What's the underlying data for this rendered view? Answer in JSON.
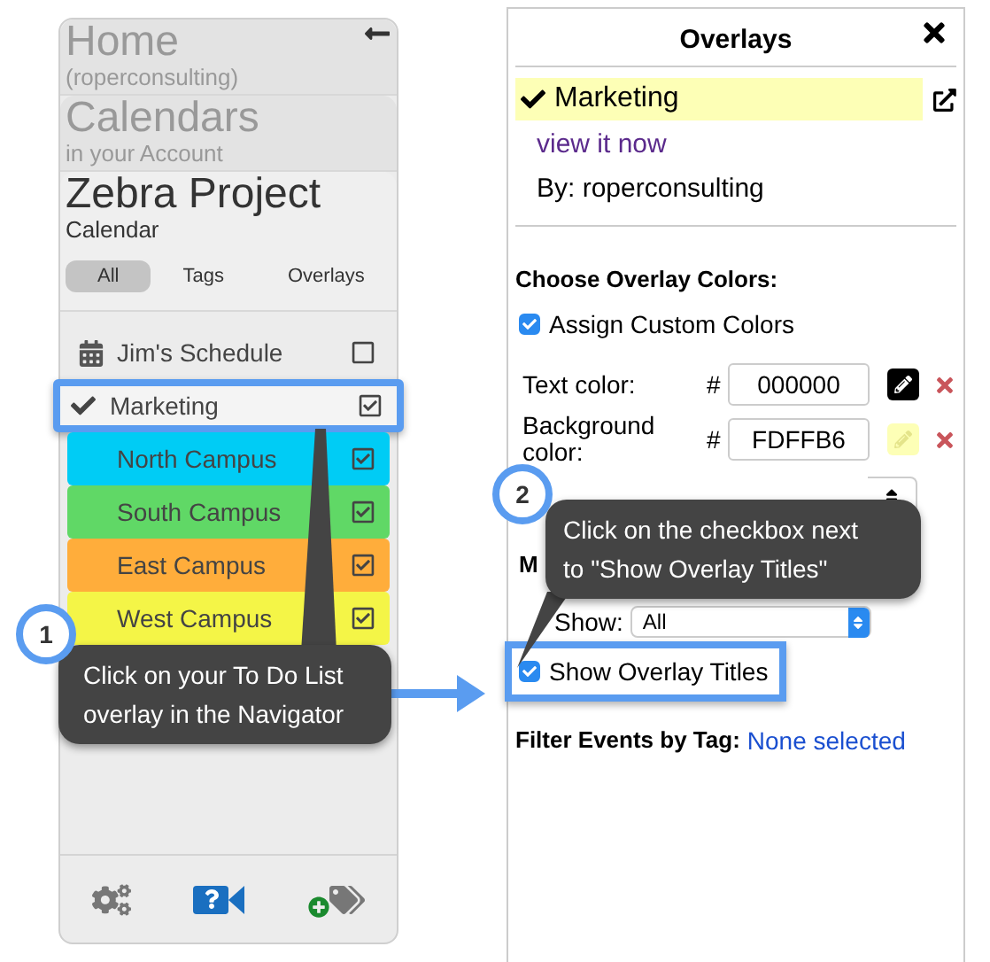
{
  "navigator": {
    "home": {
      "title": "Home",
      "subtitle": "(roperconsulting)"
    },
    "calendars": {
      "title": "Calendars",
      "subtitle": "in your Account"
    },
    "calendar": {
      "title": "Zebra Project",
      "subtitle": "Calendar"
    },
    "tabs": [
      {
        "label": "All",
        "selected": true
      },
      {
        "label": "Tags",
        "selected": false
      },
      {
        "label": "Overlays",
        "selected": false
      }
    ],
    "items": [
      {
        "kind": "calendar",
        "name": "Jim's Schedule",
        "checked": false,
        "selected": false,
        "highlighted": false
      },
      {
        "kind": "overlay",
        "name": "Marketing",
        "checked": true,
        "selected": true,
        "highlighted": true
      },
      {
        "kind": "overlay",
        "name": "North Campus",
        "checked": true,
        "selected": false,
        "highlighted": false,
        "color": "#00ccf5"
      },
      {
        "kind": "overlay",
        "name": "South Campus",
        "checked": true,
        "selected": false,
        "highlighted": false,
        "color": "#60d866"
      },
      {
        "kind": "overlay",
        "name": "East Campus",
        "checked": true,
        "selected": false,
        "highlighted": false,
        "color": "#ffad3b"
      },
      {
        "kind": "overlay",
        "name": "West Campus",
        "checked": true,
        "selected": false,
        "highlighted": false,
        "color": "#f4f547"
      }
    ]
  },
  "overlays_panel": {
    "title": "Overlays",
    "overlay": {
      "name": "Marketing",
      "selected": true
    },
    "link": "view it now",
    "owner": "By: roperconsulting",
    "colors_heading": "Choose Overlay Colors:",
    "assign_custom": {
      "label": "Assign Custom Colors",
      "checked": true
    },
    "color_fields": [
      {
        "label": "Text color:",
        "hash": "#",
        "value": "000000"
      },
      {
        "label": "Background color:",
        "hash": "#",
        "value": "FDFFB6"
      }
    ],
    "section_heading": "M",
    "show": {
      "label": "Show:",
      "value": "All"
    },
    "show_titles": {
      "label": "Show Overlay Titles",
      "checked": true,
      "highlighted": true
    },
    "filter": {
      "label": "Filter Events by Tag:",
      "link": "None selected"
    }
  },
  "callouts": [
    {
      "number": "1",
      "lines": [
        "Click on your To Do List",
        "overlay in the Navigator"
      ]
    },
    {
      "number": "2",
      "lines": [
        "Click on the checkbox next",
        "to \"Show Overlay Titles\""
      ]
    }
  ]
}
